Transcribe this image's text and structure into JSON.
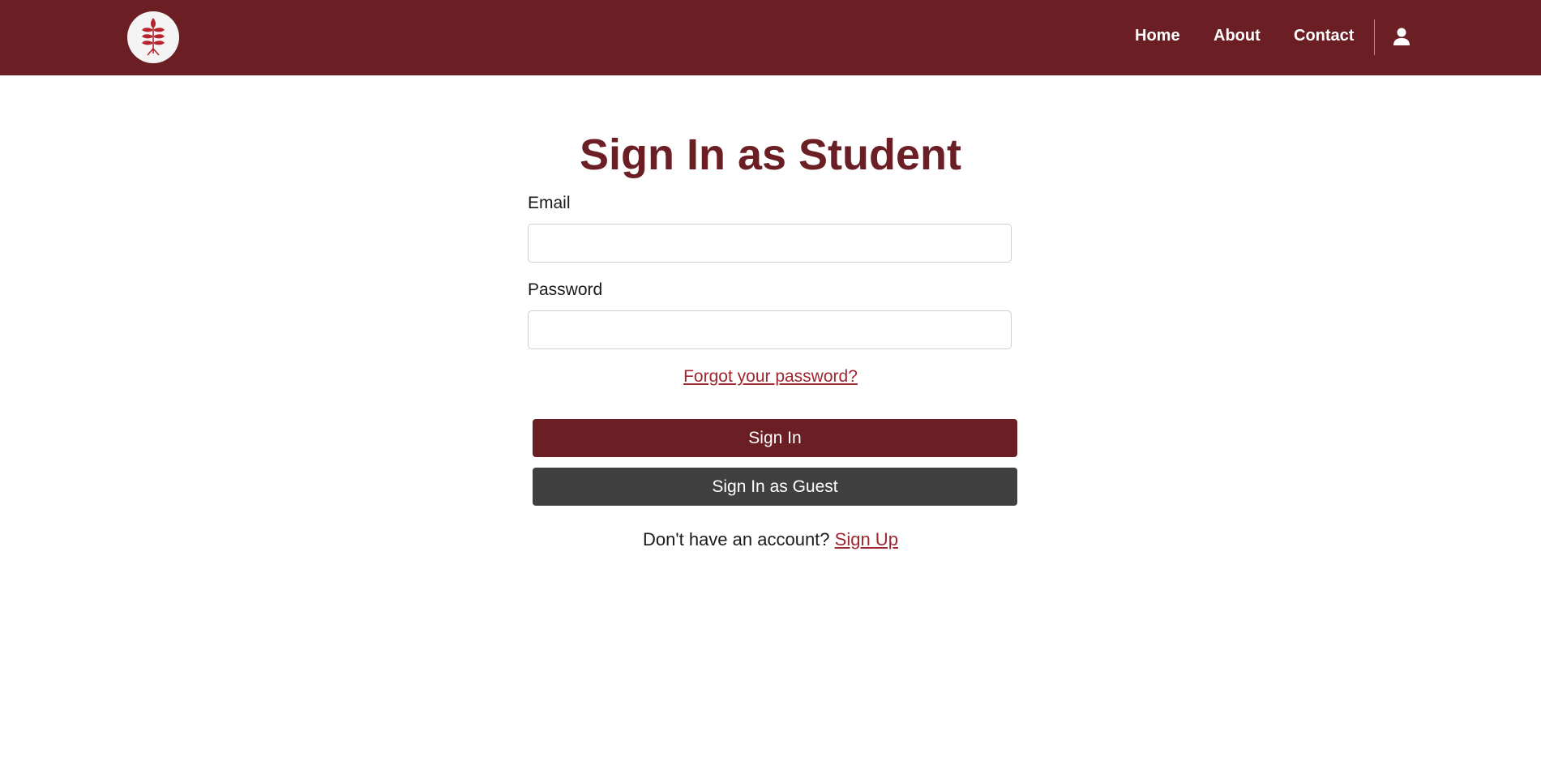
{
  "header": {
    "logo_icon": "wheat-leaf-icon",
    "nav": [
      {
        "label": "Home"
      },
      {
        "label": "About"
      },
      {
        "label": "Contact"
      }
    ],
    "account_icon": "user-icon"
  },
  "main": {
    "title": "Sign In as Student",
    "email": {
      "label": "Email",
      "value": "",
      "placeholder": ""
    },
    "password": {
      "label": "Password",
      "value": "",
      "placeholder": ""
    },
    "forgot_link": "Forgot your password?",
    "signin_button": "Sign In",
    "guest_button": "Sign In as Guest",
    "signup_prompt": "Don't have an account?",
    "signup_link": "Sign Up"
  },
  "colors": {
    "brand": "#6b1f25",
    "link": "#a02631",
    "guest_button": "#404040"
  }
}
